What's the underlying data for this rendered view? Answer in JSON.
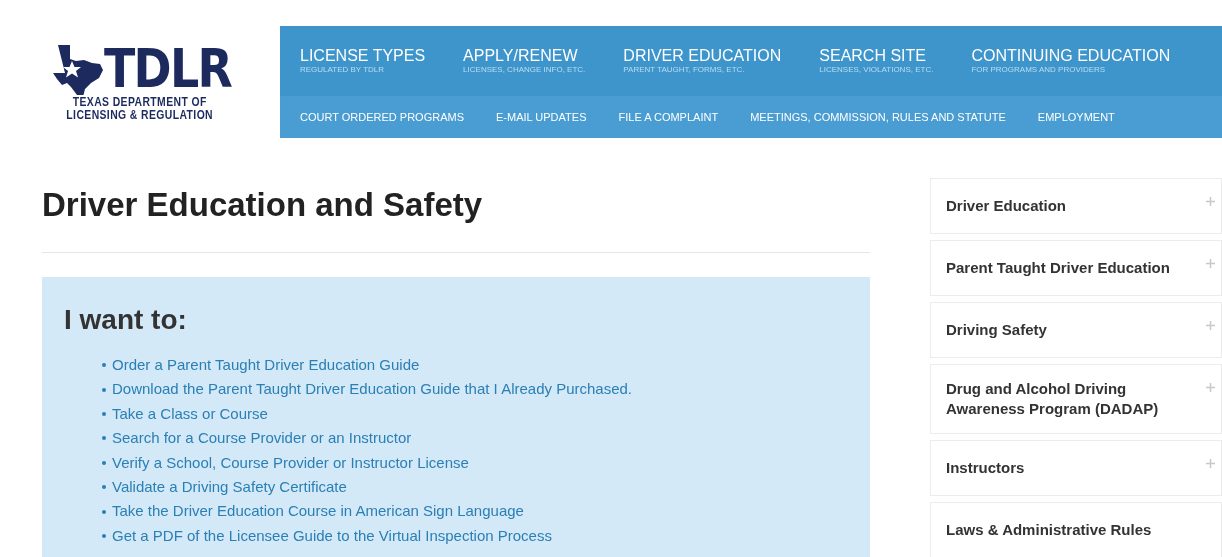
{
  "logo": {
    "mark": "TDLR",
    "subtitle_lines": [
      "TEXAS DEPARTMENT OF",
      "LICENSING & REGULATION"
    ]
  },
  "main_nav": [
    {
      "label": "LICENSE TYPES",
      "sub": "REGULATED BY TDLR"
    },
    {
      "label": "APPLY/RENEW",
      "sub": "LICENSES, CHANGE INFO, ETC."
    },
    {
      "label": "DRIVER EDUCATION",
      "sub": "PARENT TAUGHT, FORMS, ETC."
    },
    {
      "label": "SEARCH SITE",
      "sub": "LICENSES, VIOLATIONS, ETC."
    },
    {
      "label": "CONTINUING EDUCATION",
      "sub": "FOR PROGRAMS AND PROVIDERS"
    }
  ],
  "sub_nav": [
    "COURT ORDERED PROGRAMS",
    "E-MAIL UPDATES",
    "FILE A COMPLAINT",
    "MEETINGS, COMMISSION, RULES AND STATUTE",
    "EMPLOYMENT"
  ],
  "page_title": "Driver Education and Safety",
  "panel": {
    "heading": "I want to:",
    "links": [
      "Order a Parent Taught Driver Education Guide",
      "Download the Parent Taught Driver Education Guide that I Already Purchased.",
      "Take a Class or Course",
      "Search for a Course Provider or an Instructor",
      "Verify a School, Course Provider or Instructor License",
      "Validate a Driving Safety Certificate",
      "Take the Driver Education Course in American Sign Language",
      "Get a PDF of the Licensee Guide to the Virtual Inspection Process"
    ]
  },
  "sidebar": [
    {
      "label": "Driver Education",
      "expandable": true
    },
    {
      "label": "Parent Taught Driver Education",
      "expandable": true
    },
    {
      "label": "Driving Safety",
      "expandable": true
    },
    {
      "label": "Drug and Alcohol Driving Awareness Program (DADAP)",
      "expandable": true
    },
    {
      "label": "Instructors",
      "expandable": true
    },
    {
      "label": "Laws & Administrative Rules",
      "expandable": false
    }
  ]
}
